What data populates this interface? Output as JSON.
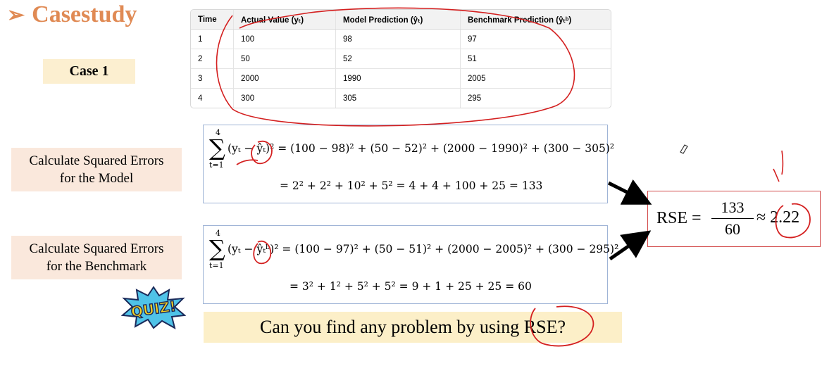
{
  "title": "Casestudy",
  "title_bullet": "➢",
  "case_label": "Case 1",
  "table": {
    "headers": [
      "Time",
      "Actual Value (yₜ)",
      "Model Prediction (ŷₜ)",
      "Benchmark Prediction (ŷₜᵇ)"
    ],
    "rows": [
      [
        "1",
        "100",
        "98",
        "97"
      ],
      [
        "2",
        "50",
        "52",
        "51"
      ],
      [
        "3",
        "2000",
        "1990",
        "2005"
      ],
      [
        "4",
        "300",
        "305",
        "295"
      ]
    ]
  },
  "model_section": {
    "label_line1": "Calculate Squared Errors",
    "label_line2": "for the Model",
    "sum_upper": "4",
    "sum_lower": "t=1",
    "eq_line1": "(yₜ − ŷₜ)² = (100 − 98)² + (50 − 52)² + (2000 − 1990)² + (300 − 305)²",
    "eq_line2": "= 2² + 2² + 10² + 5² = 4 + 4 + 100 + 25 = 133"
  },
  "benchmark_section": {
    "label_line1": "Calculate Squared Errors",
    "label_line2": "for the Benchmark",
    "sum_upper": "4",
    "sum_lower": "t=1",
    "eq_line1": "(yₜ − ŷₜᵇ)² = (100 − 97)² + (50 − 51)² + (2000 − 2005)² + (300 − 295)²",
    "eq_line2": "= 3² + 1² + 5² + 5² = 9 + 1 + 25 + 25 = 60"
  },
  "rse": {
    "label": "RSE =",
    "numerator": "133",
    "denominator": "60",
    "approx": "≈ 2.22"
  },
  "quiz_badge_text": "QUIZ!",
  "question": "Can you find any problem by using RSE?",
  "colors": {
    "title": "#e08a54",
    "annotation_red": "#d42020",
    "case_bg": "#fcefd0",
    "side_bg": "#fae8dc",
    "question_bg": "#fcefc8",
    "box_border": "#9fb4d6",
    "rse_border": "#d24a4a"
  }
}
